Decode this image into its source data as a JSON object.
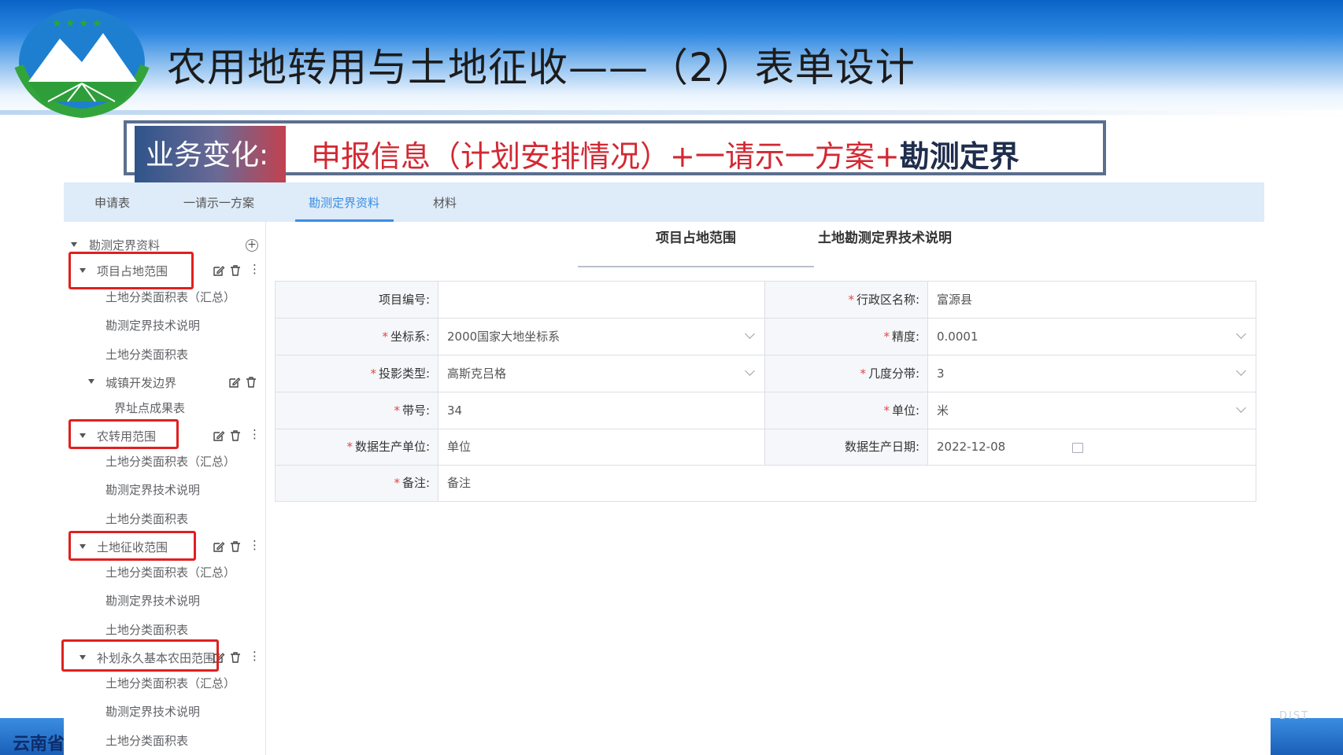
{
  "slide": {
    "title": "农用地转用与土地征收——（2）表单设计",
    "banner_label": "业务变化:",
    "banner_red": "申报信息（计划安排情况）+一请示一方案+",
    "banner_dark": "勘测定界",
    "footer_left": "云南省",
    "footer_right_mark": "DIST"
  },
  "tabs": [
    "申请表",
    "一请示一方案",
    "勘测定界资料",
    "材料"
  ],
  "active_tab": "勘测定界资料",
  "tree": {
    "root": "勘测定界资料",
    "items": [
      "项目占地范围",
      "土地分类面积表（汇总）",
      "勘测定界技术说明",
      "土地分类面积表",
      "城镇开发边界",
      "界址点成果表",
      "农转用范围",
      "土地分类面积表（汇总）",
      "勘测定界技术说明",
      "土地分类面积表",
      "土地征收范围",
      "土地分类面积表（汇总）",
      "勘测定界技术说明",
      "土地分类面积表",
      "补划永久基本农田范围",
      "土地分类面积表（汇总）",
      "勘测定界技术说明",
      "土地分类面积表"
    ]
  },
  "subtabs": [
    "项目占地范围",
    "土地勘测定界技术说明"
  ],
  "form": {
    "required_mark": "*",
    "project_no_label": "项目编号:",
    "project_no_value": "",
    "admin_label": "行政区名称:",
    "admin_value": "富源县",
    "coord_label": "坐标系:",
    "coord_value": "2000国家大地坐标系",
    "precision_label": "精度:",
    "precision_value": "0.0001",
    "projection_label": "投影类型:",
    "projection_value": "高斯克吕格",
    "zone_deg_label": "几度分带:",
    "zone_deg_value": "3",
    "zone_no_label": "带号:",
    "zone_no_value": "34",
    "unit_label": "单位:",
    "unit_value": "米",
    "producer_label": "数据生产单位:",
    "producer_value": "单位",
    "date_label": "数据生产日期:",
    "date_value": "2022-12-08",
    "remark_label": "备注:",
    "remark_value": "备注"
  },
  "colors": {
    "accent": "#3a8ee6",
    "required": "#e64545",
    "highlight_box": "#e02020",
    "banner_red": "#d32832"
  },
  "icons": [
    "add-circle-icon",
    "edit-icon",
    "delete-icon",
    "more-icon",
    "caret-down-icon",
    "chevron-down-icon",
    "calendar-icon"
  ]
}
